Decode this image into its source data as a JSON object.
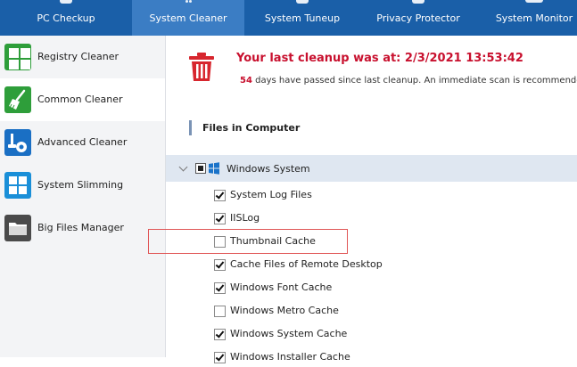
{
  "nav": {
    "tabs": [
      {
        "label": "PC Checkup",
        "active": false
      },
      {
        "label": "System Cleaner",
        "active": true
      },
      {
        "label": "System Tuneup",
        "active": false
      },
      {
        "label": "Privacy Protector",
        "active": false
      },
      {
        "label": "System Monitor",
        "active": false
      }
    ]
  },
  "sidebar": {
    "items": [
      {
        "label": "Registry Cleaner",
        "icon": "registry-grid-icon",
        "color": "#2e9e3a"
      },
      {
        "label": "Common Cleaner",
        "icon": "broom-icon",
        "color": "#2e9e3a",
        "active": true
      },
      {
        "label": "Advanced Cleaner",
        "icon": "vacuum-icon",
        "color": "#1a6fc4"
      },
      {
        "label": "System Slimming",
        "icon": "windows-logo-icon",
        "color": "#1a8fd8"
      },
      {
        "label": "Big Files Manager",
        "icon": "folder-icon",
        "color": "#4a4a4a"
      }
    ]
  },
  "main": {
    "last_cleanup_text": "Your last cleanup was at: 2/3/2021 13:53:42",
    "days_count": "54",
    "days_text": " days have passed since last cleanup. An immediate scan is recommended.",
    "section_title": "Files in Computer",
    "group_label": "Windows System",
    "items": [
      {
        "label": "System Log Files",
        "checked": true
      },
      {
        "label": "IISLog",
        "checked": true
      },
      {
        "label": "Thumbnail Cache",
        "checked": false
      },
      {
        "label": "Cache Files of Remote Desktop",
        "checked": true
      },
      {
        "label": "Windows Font Cache",
        "checked": true
      },
      {
        "label": "Windows Metro Cache",
        "checked": false
      },
      {
        "label": "Windows System Cache",
        "checked": true
      },
      {
        "label": "Windows Installer Cache",
        "checked": true
      }
    ]
  },
  "colors": {
    "nav_bg": "#1a5fa8",
    "nav_active": "#3b7dc4",
    "accent_red": "#c8102e",
    "highlight_border": "#e05555"
  }
}
